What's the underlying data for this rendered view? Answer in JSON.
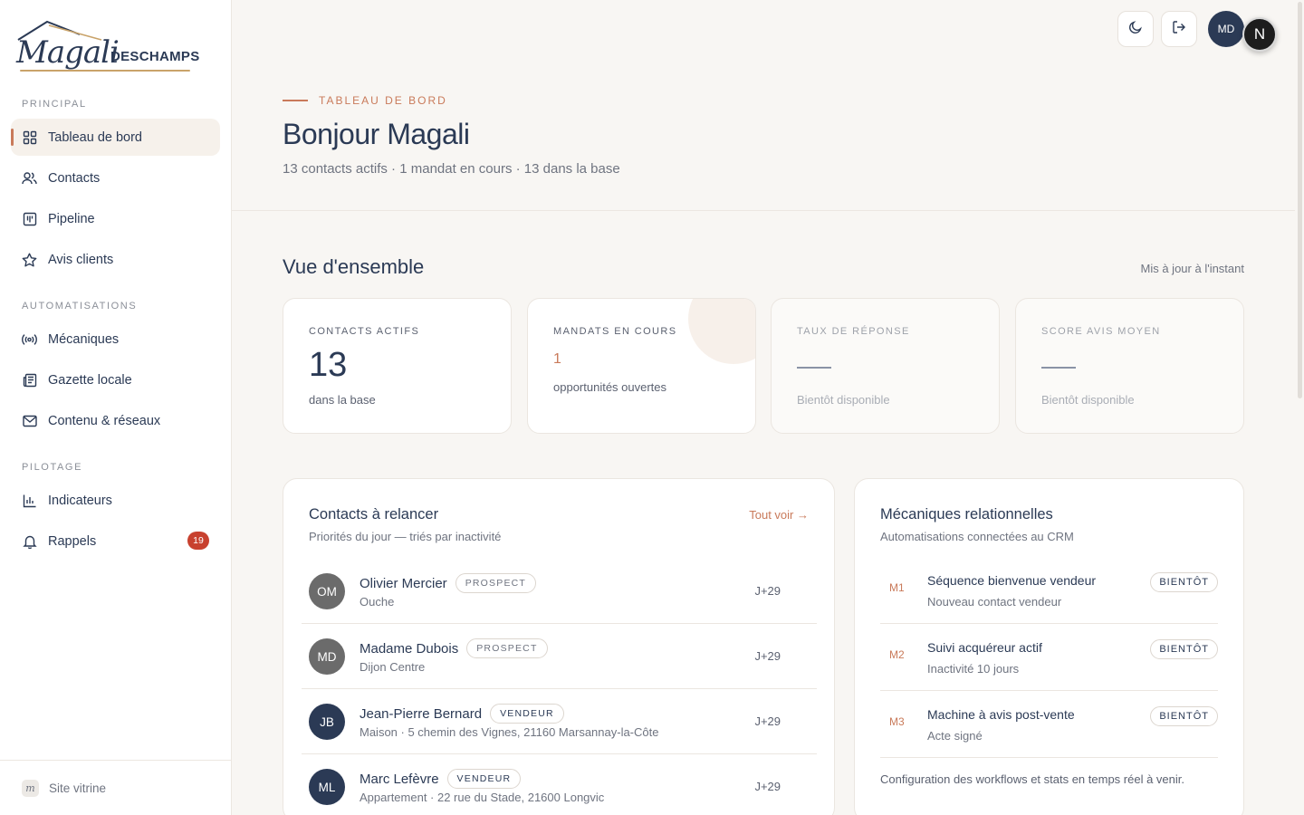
{
  "brand": {
    "script_name": "Magali",
    "surname": "DESCHAMPS"
  },
  "sidebar": {
    "sections": {
      "principal": "PRINCIPAL",
      "automatisations": "AUTOMATISATIONS",
      "pilotage": "PILOTAGE"
    },
    "items": [
      {
        "label": "Tableau de bord",
        "icon": "grid-icon",
        "active": true
      },
      {
        "label": "Contacts",
        "icon": "users-icon"
      },
      {
        "label": "Pipeline",
        "icon": "kanban-icon"
      },
      {
        "label": "Avis clients",
        "icon": "star-icon"
      },
      {
        "label": "Mécaniques",
        "icon": "broadcast-icon"
      },
      {
        "label": "Gazette locale",
        "icon": "newspaper-icon"
      },
      {
        "label": "Contenu & réseaux",
        "icon": "mail-icon"
      },
      {
        "label": "Indicateurs",
        "icon": "bar-chart-icon"
      },
      {
        "label": "Rappels",
        "icon": "bell-icon",
        "badge": "19"
      }
    ],
    "footer": {
      "label": "Site vitrine",
      "mini_logo": "m"
    }
  },
  "topbar": {
    "user_initials": "MD",
    "floating_avatar": "N"
  },
  "header": {
    "eyebrow": "TABLEAU DE BORD",
    "title": "Bonjour Magali",
    "subtitle": "13 contacts actifs · 1 mandat en cours · 13 dans la base"
  },
  "overview": {
    "title": "Vue d'ensemble",
    "updated": "Mis à jour à l'instant",
    "stats": [
      {
        "label": "CONTACTS ACTIFS",
        "value": "13",
        "desc": "dans la base"
      },
      {
        "label": "MANDATS EN COURS",
        "value": "1",
        "desc": "opportunités ouvertes"
      },
      {
        "label": "TAUX DE RÉPONSE",
        "value": "",
        "desc": "Bientôt disponible"
      },
      {
        "label": "SCORE AVIS MOYEN",
        "value": "",
        "desc": "Bientôt disponible"
      }
    ]
  },
  "contacts_panel": {
    "title": "Contacts à relancer",
    "subtitle": "Priorités du jour — triés par inactivité",
    "see_all": "Tout voir →",
    "rows": [
      {
        "initials": "OM",
        "name": "Olivier Mercier",
        "tag": "PROSPECT",
        "meta": "Ouche",
        "delay": "J+29",
        "color": "#6b6b6b"
      },
      {
        "initials": "MD",
        "name": "Madame Dubois",
        "tag": "PROSPECT",
        "meta": "Dijon Centre",
        "delay": "J+29",
        "color": "#6b6b6b"
      },
      {
        "initials": "JB",
        "name": "Jean-Pierre Bernard",
        "tag": "VENDEUR",
        "meta": "Maison · 5 chemin des Vignes, 21160 Marsannay-la-Côte",
        "delay": "J+29",
        "color": "#2b3a55"
      },
      {
        "initials": "ML",
        "name": "Marc Lefèvre",
        "tag": "VENDEUR",
        "meta": "Appartement · 22 rue du Stade, 21600 Longvic",
        "delay": "J+29",
        "color": "#2b3a55"
      }
    ]
  },
  "mechanics_panel": {
    "title": "Mécaniques relationnelles",
    "subtitle": "Automatisations connectées au CRM",
    "rows": [
      {
        "code": "M1",
        "name": "Séquence bienvenue vendeur",
        "desc": "Nouveau contact vendeur",
        "status": "BIENTÔT"
      },
      {
        "code": "M2",
        "name": "Suivi acquéreur actif",
        "desc": "Inactivité 10 jours",
        "status": "BIENTÔT"
      },
      {
        "code": "M3",
        "name": "Machine à avis post-vente",
        "desc": "Acte signé",
        "status": "BIENTÔT"
      }
    ],
    "footer": "Configuration des workflows et stats en temps réel à venir."
  },
  "colors": {
    "navy": "#2b3a55",
    "accent": "#c97a5a",
    "badge": "#c8412f",
    "background": "#f8f6f3"
  }
}
